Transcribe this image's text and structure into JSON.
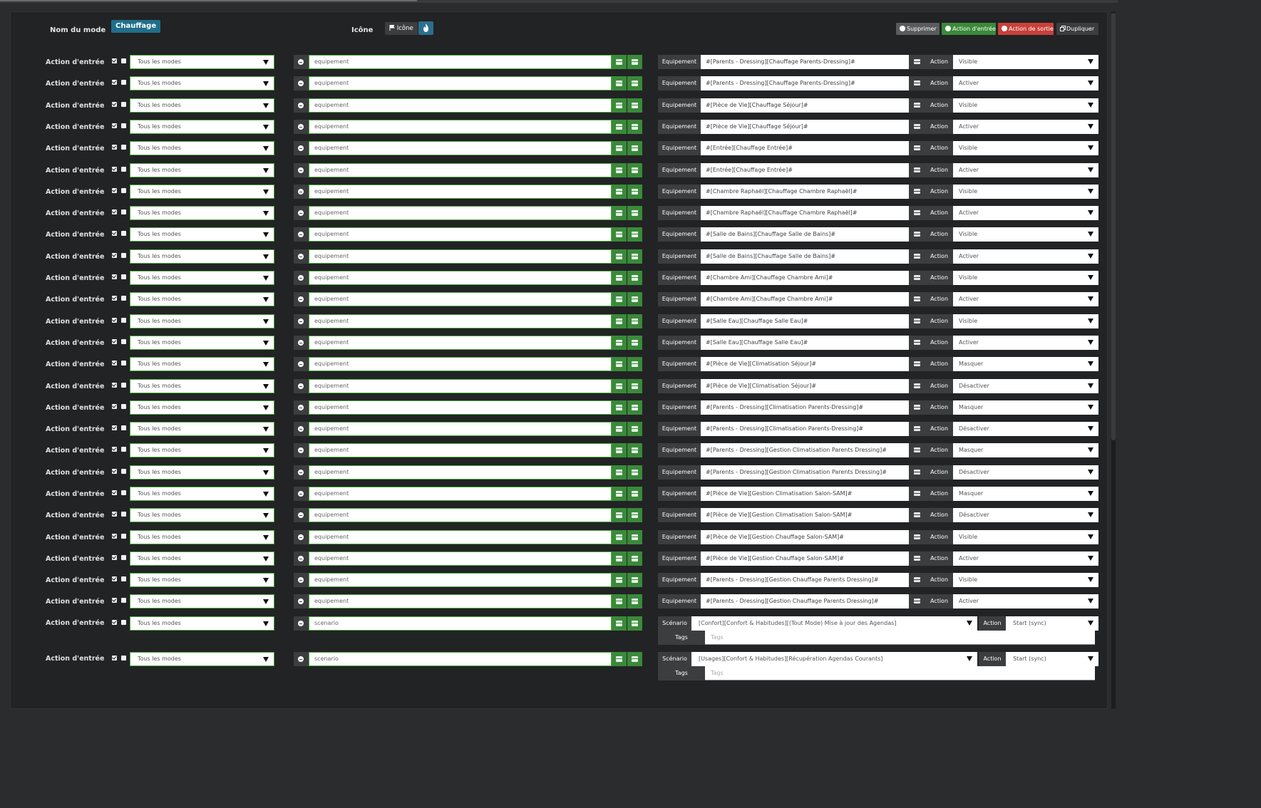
{
  "header": {
    "mode_name_label": "Nom du mode",
    "mode_name_value": "Chauffage",
    "icon_label": "Icône",
    "icon_button_label": "Icône",
    "buttons": {
      "delete": "Supprimer",
      "entry_action": "Action d'entrée",
      "exit_action": "Action de sortie",
      "duplicate": "Dupliquer"
    }
  },
  "colors": {
    "badge": "#1f6f8b",
    "delete_btn": "#5a5b5c",
    "entry_btn": "#3a8a3a",
    "exit_btn": "#c9403a",
    "duplicate_btn": "#3c3d3e",
    "input_border": "#4aa63f"
  },
  "labels": {
    "row_label": "Action d'entrée",
    "modes_value": "Tous les modes",
    "equipment_label": "Equipement",
    "action_label": "Action",
    "scenario_label": "Scénario",
    "tags_label": "Tags",
    "tags_placeholder": "Tags"
  },
  "rows": [
    {
      "type": "equipement",
      "cmd": "#[Parents - Dressing][Chauffage Parents-Dressing]#",
      "action": "Visible"
    },
    {
      "type": "equipement",
      "cmd": "#[Parents - Dressing][Chauffage Parents-Dressing]#",
      "action": "Activer"
    },
    {
      "type": "equipement",
      "cmd": "#[Pièce de Vie][Chauffage Séjour]#",
      "action": "Visible"
    },
    {
      "type": "equipement",
      "cmd": "#[Pièce de Vie][Chauffage Séjour]#",
      "action": "Activer"
    },
    {
      "type": "equipement",
      "cmd": "#[Entrée][Chauffage Entrée]#",
      "action": "Visible"
    },
    {
      "type": "equipement",
      "cmd": "#[Entrée][Chauffage Entrée]#",
      "action": "Activer"
    },
    {
      "type": "equipement",
      "cmd": "#[Chambre Raphaël][Chauffage Chambre Raphaël]#",
      "action": "Visible"
    },
    {
      "type": "equipement",
      "cmd": "#[Chambre Raphaël][Chauffage Chambre Raphaël]#",
      "action": "Activer"
    },
    {
      "type": "equipement",
      "cmd": "#[Salle de Bains][Chauffage Salle de Bains]#",
      "action": "Visible"
    },
    {
      "type": "equipement",
      "cmd": "#[Salle de Bains][Chauffage Salle de Bains]#",
      "action": "Activer"
    },
    {
      "type": "equipement",
      "cmd": "#[Chambre Ami][Chauffage Chambre Ami]#",
      "action": "Visible"
    },
    {
      "type": "equipement",
      "cmd": "#[Chambre Ami][Chauffage Chambre Ami]#",
      "action": "Activer"
    },
    {
      "type": "equipement",
      "cmd": "#[Salle Eau][Chauffage Salle Eau]#",
      "action": "Visible"
    },
    {
      "type": "equipement",
      "cmd": "#[Salle Eau][Chauffage Salle Eau]#",
      "action": "Activer"
    },
    {
      "type": "equipement",
      "cmd": "#[Pièce de Vie][Climatisation Séjour]#",
      "action": "Masquer"
    },
    {
      "type": "equipement",
      "cmd": "#[Pièce de Vie][Climatisation Séjour]#",
      "action": "Désactiver"
    },
    {
      "type": "equipement",
      "cmd": "#[Parents - Dressing][Climatisation Parents-Dressing]#",
      "action": "Masquer"
    },
    {
      "type": "equipement",
      "cmd": "#[Parents - Dressing][Climatisation Parents-Dressing]#",
      "action": "Désactiver"
    },
    {
      "type": "equipement",
      "cmd": "#[Parents - Dressing][Gestion Climatisation Parents Dressing]#",
      "action": "Masquer"
    },
    {
      "type": "equipement",
      "cmd": "#[Parents - Dressing][Gestion Climatisation Parents Dressing]#",
      "action": "Désactiver"
    },
    {
      "type": "equipement",
      "cmd": "#[Pièce de Vie][Gestion Climatisation Salon-SAM]#",
      "action": "Masquer"
    },
    {
      "type": "equipement",
      "cmd": "#[Pièce de Vie][Gestion Climatisation Salon-SAM]#",
      "action": "Désactiver"
    },
    {
      "type": "equipement",
      "cmd": "#[Pièce de Vie][Gestion Chauffage Salon-SAM]#",
      "action": "Visible"
    },
    {
      "type": "equipement",
      "cmd": "#[Pièce de Vie][Gestion Chauffage Salon-SAM]#",
      "action": "Activer"
    },
    {
      "type": "equipement",
      "cmd": "#[Parents - Dressing][Gestion Chauffage Parents Dressing]#",
      "action": "Visible"
    },
    {
      "type": "equipement",
      "cmd": "#[Parents - Dressing][Gestion Chauffage Parents Dressing]#",
      "action": "Activer"
    },
    {
      "type": "scenario",
      "cmd": "[Confort][Confort & Habitudes][(Tout Mode) Mise à jour des Agendas]",
      "action": "Start (sync)"
    },
    {
      "type": "scenario",
      "cmd": "[Usages][Confort & Habitudes][Récupération Agendas Courants]",
      "action": "Start (sync)"
    }
  ]
}
